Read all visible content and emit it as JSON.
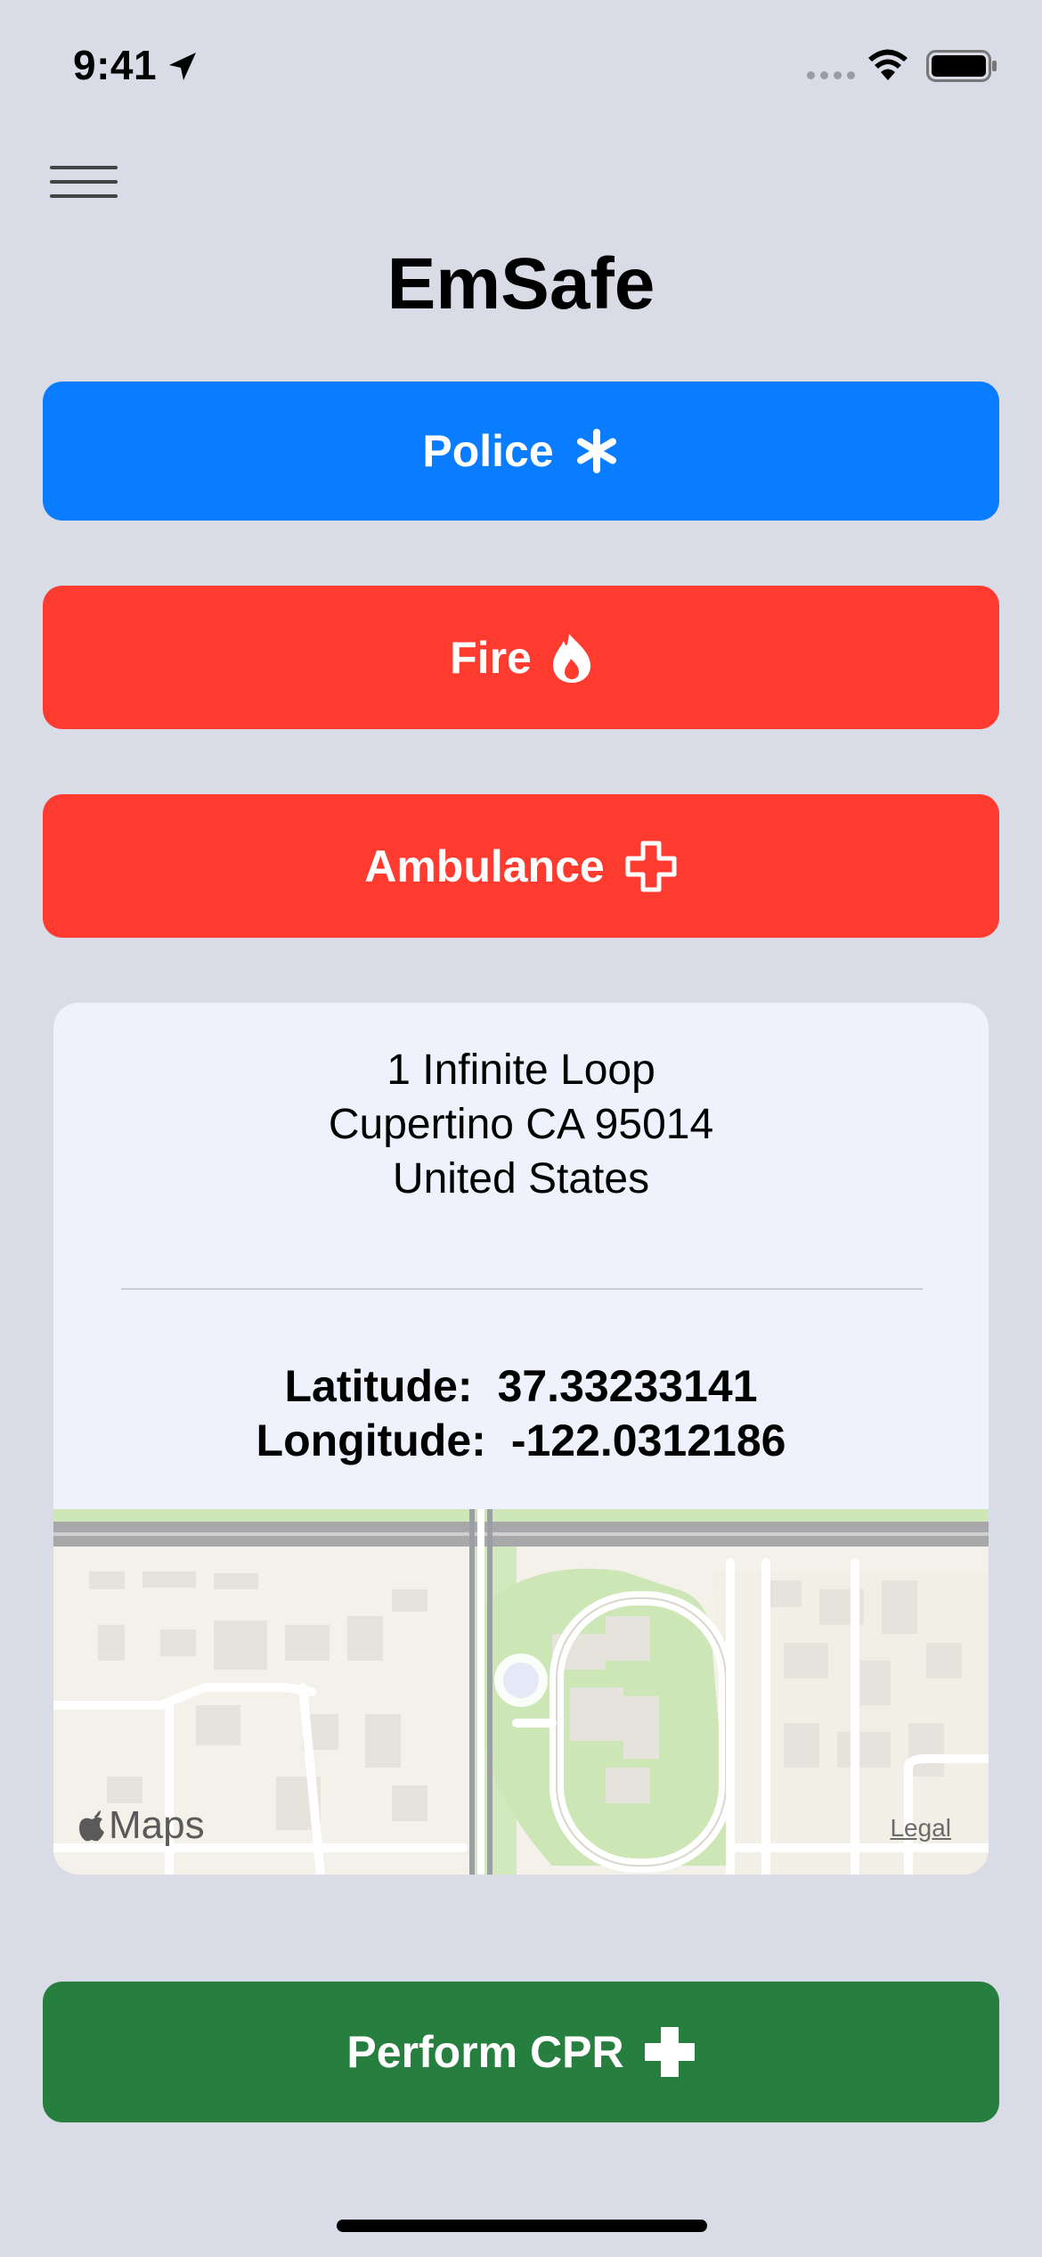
{
  "status_bar": {
    "time": "9:41"
  },
  "app": {
    "title": "EmSafe"
  },
  "buttons": {
    "police": {
      "label": "Police",
      "color": "#0a7cff",
      "icon": "asterisk-icon"
    },
    "fire": {
      "label": "Fire",
      "color": "#ff3b30",
      "icon": "flame-icon"
    },
    "ambulance": {
      "label": "Ambulance",
      "color": "#ff3b30",
      "icon": "medical-cross-outline-icon"
    },
    "cpr": {
      "label": "Perform CPR",
      "color": "#277f3f",
      "icon": "medical-cross-icon"
    }
  },
  "location": {
    "address_lines": [
      "1 Infinite Loop",
      "Cupertino CA 95014",
      "United States"
    ],
    "latitude_label": "Latitude:",
    "latitude": "37.33233141",
    "longitude_label": "Longitude:",
    "longitude": "-122.0312186"
  },
  "map": {
    "logo_text": "Maps",
    "legal_label": "Legal"
  }
}
